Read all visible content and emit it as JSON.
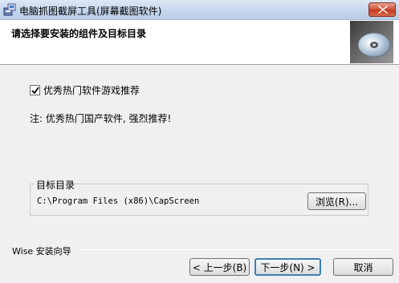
{
  "window": {
    "title": "电脑抓图截屏工具(屏幕截图软件)",
    "app_icon": "installer-icon",
    "close_icon": "close-icon"
  },
  "header": {
    "title": "请选择要安装的组件及目标目录",
    "image": "cd-disc-icon"
  },
  "components": [
    {
      "label": "优秀热门软件游戏推荐",
      "checked": true
    }
  ],
  "note": "注: 优秀热门国产软件, 强烈推荐!",
  "destination": {
    "group_label": "目标目录",
    "path": "C:\\Program Files (x86)\\CapScreen",
    "browse_label": "浏览(R)..."
  },
  "footer": {
    "brand": "Wise 安装向导",
    "back_label": "< 上一步(B)",
    "next_label": "下一步(N) >",
    "cancel_label": "取消"
  }
}
